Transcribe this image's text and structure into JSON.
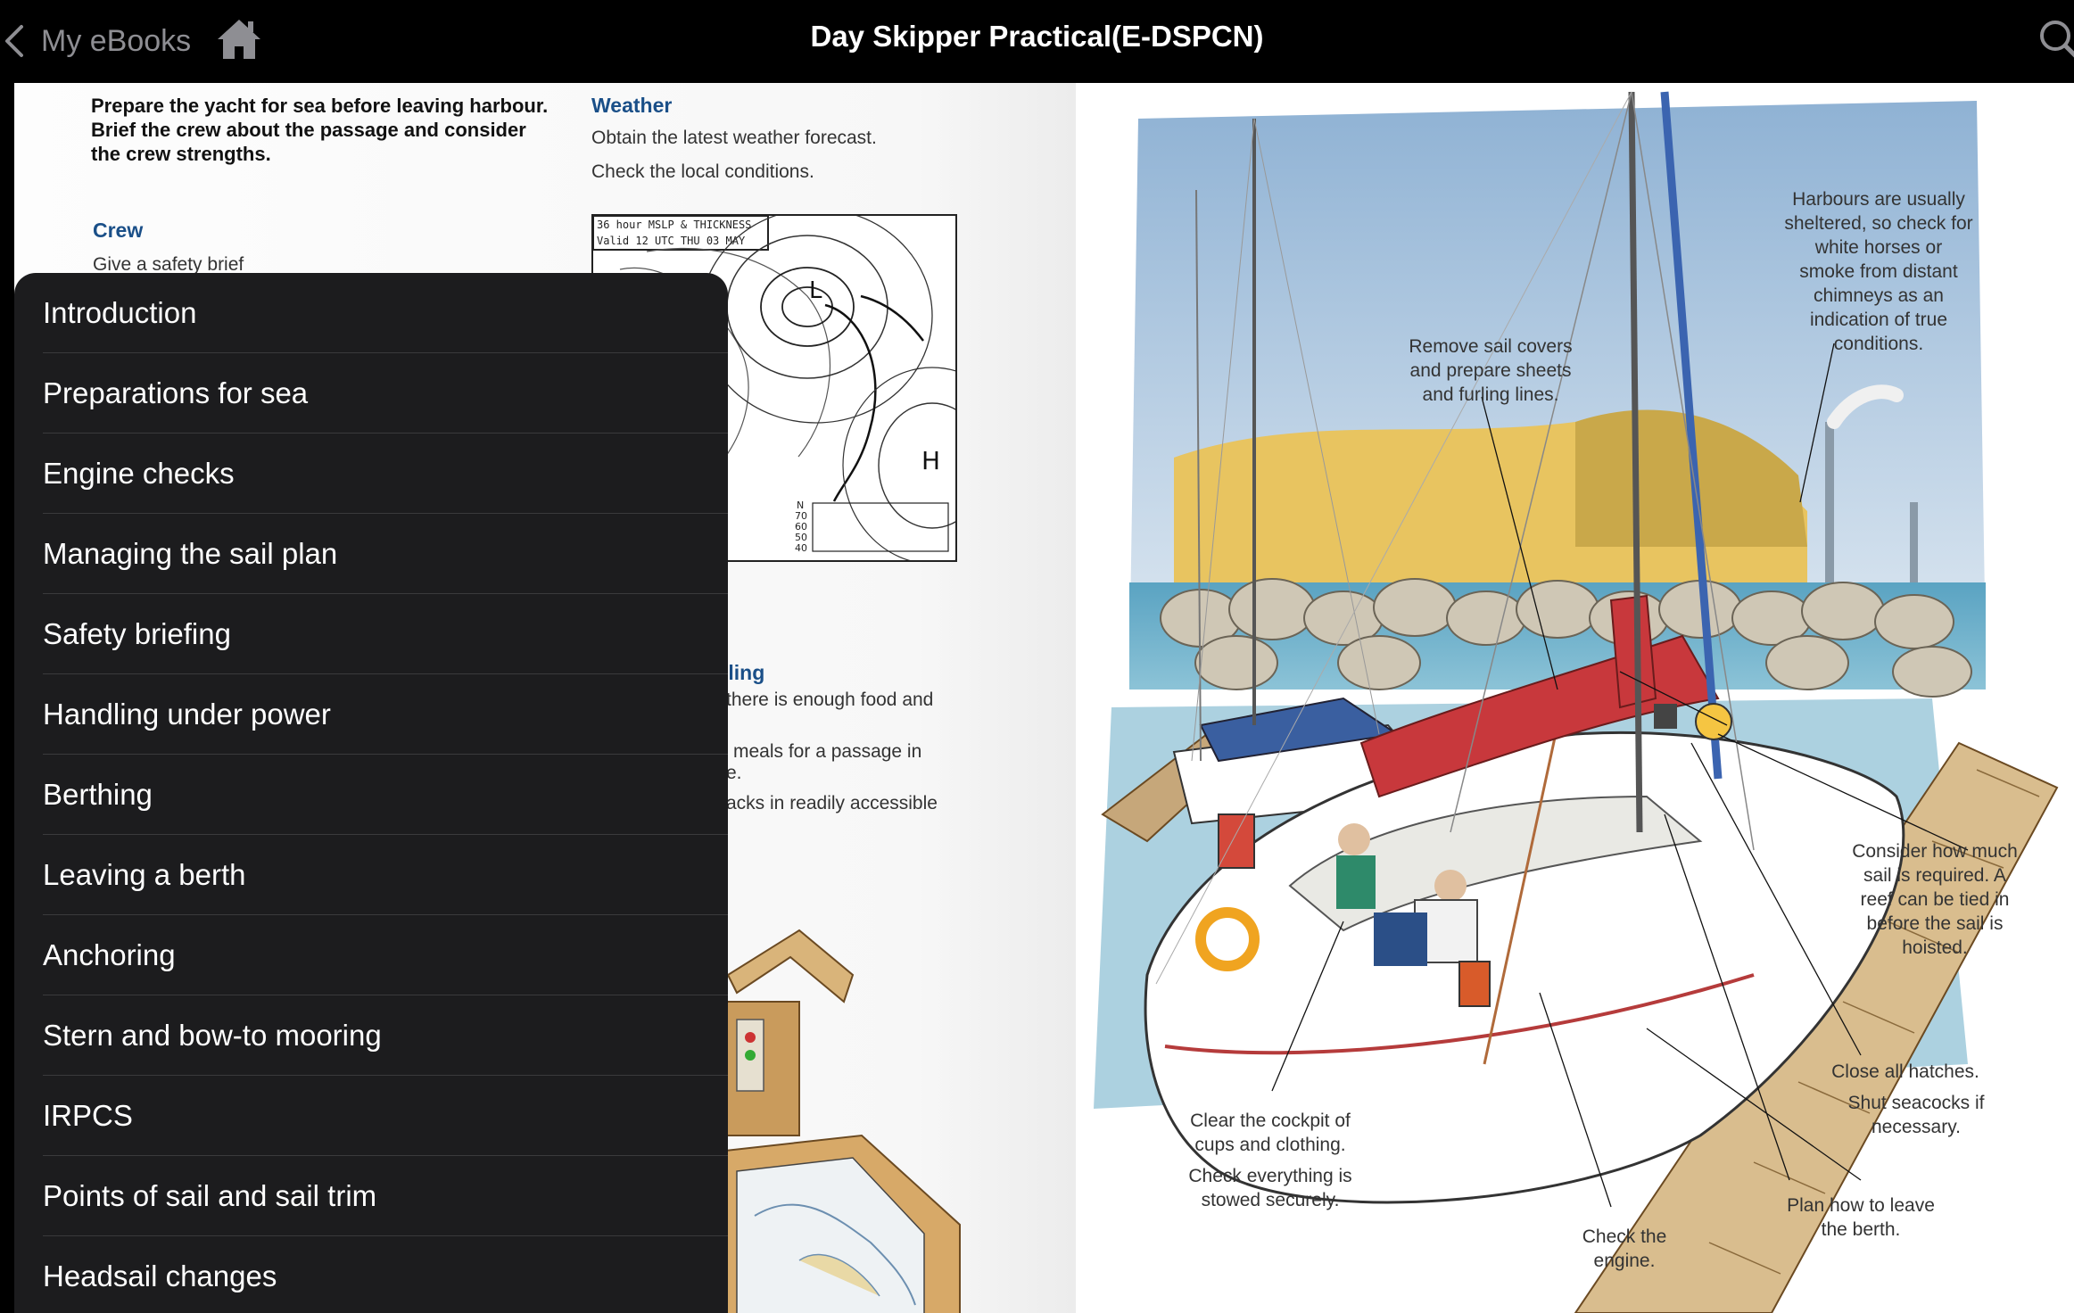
{
  "topbar": {
    "back_label": "My eBooks",
    "title": "Day Skipper Practical(E-DSPCN)"
  },
  "page": {
    "intro": "Prepare the yacht for sea before leaving harbour. Brief the crew about the passage and consider the crew strengths.",
    "crew": {
      "heading": "Crew",
      "line1": "Give a safety brief"
    },
    "weather": {
      "heading": "Weather",
      "line1": "Obtain the latest weather forecast.",
      "line2": "Check the local conditions."
    },
    "weather_map": {
      "caption1": "36 hour MSLP & THICKNESS",
      "caption2": "Valid 12 UTC THU 03 MAY",
      "high_label": "H",
      "low_label": "L",
      "north_label": "N",
      "scale": [
        "70",
        "60",
        "50",
        "40"
      ]
    },
    "victualling": {
      "heading_fragment": "lling",
      "line1": "there is enough food and",
      "line2": "meals for a passage in",
      "line3": "e.",
      "line4": "acks in readily accessible"
    },
    "callouts": {
      "harbours": [
        "Harbours are usually",
        "sheltered, so check for",
        "white horses or",
        "smoke from distant",
        "chimneys as an",
        "indication of true",
        "conditions."
      ],
      "sail_covers": [
        "Remove sail covers",
        "and prepare sheets",
        "and furling lines."
      ],
      "reef": [
        "Consider how much",
        "sail is required. A",
        "reef can be tied in",
        "before the sail is",
        "hoisted."
      ],
      "hatches": [
        "Close all hatches."
      ],
      "seacocks": [
        "Shut seacocks if",
        "necessary."
      ],
      "cockpit": [
        "Clear the cockpit of",
        "cups and clothing."
      ],
      "stowed": [
        "Check everything is",
        "stowed securely."
      ],
      "leave_berth": [
        "Plan how to leave",
        "the berth."
      ],
      "engine": [
        "Check the",
        "engine."
      ]
    }
  },
  "toc": {
    "items": [
      "Introduction",
      "Preparations for sea",
      "Engine checks",
      "Managing the sail plan",
      "Safety briefing",
      "Handling under power",
      "Berthing",
      "Leaving a berth",
      "Anchoring",
      "Stern and bow-to mooring",
      "IRPCS",
      "Points of sail and sail trim",
      "Headsail changes"
    ]
  },
  "colors": {
    "topbar_bg": "#000000",
    "menu_bg": "#1c1c1e",
    "heading_blue": "#1a4f88",
    "sail_red": "#c8383c"
  }
}
